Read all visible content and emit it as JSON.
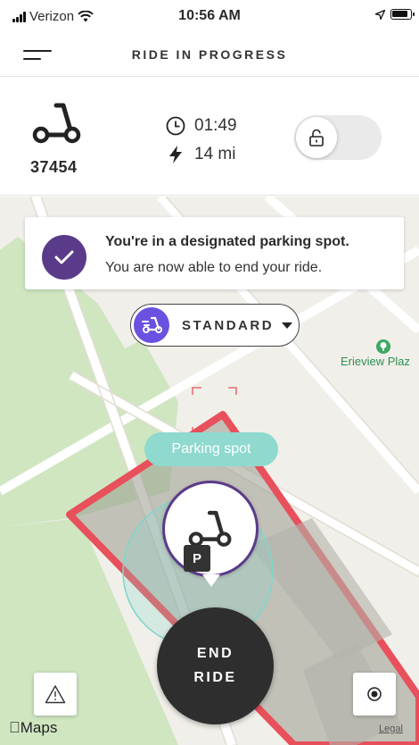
{
  "status_bar": {
    "carrier": "Verizon",
    "time": "10:56 AM"
  },
  "header": {
    "title": "RIDE IN PROGRESS",
    "menu_icon": "hamburger-menu-icon"
  },
  "ride": {
    "vehicle_id": "37454",
    "duration": "01:49",
    "range": "14 mi",
    "vehicle_icon": "scooter-icon",
    "lock_icon": "padlock-icon",
    "lock_state": "unlocked"
  },
  "notice": {
    "title": "You're in a designated parking spot.",
    "body": "You are now able to end your ride.",
    "icon": "check-icon",
    "color": "#5a3b8a"
  },
  "mode": {
    "label": "STANDARD",
    "color": "#6a51e0"
  },
  "map": {
    "poi_label": "Erieview Plaz",
    "parking_tooltip": "Parking spot",
    "parking_badge": "P",
    "zone_color": "#e8505b",
    "brand": "Maps",
    "legal": "Legal"
  },
  "actions": {
    "end_ride_line1": "END",
    "end_ride_line2": "RIDE",
    "report_icon": "warning-icon",
    "locate_icon": "location-target-icon"
  },
  "colors": {
    "accent_purple": "#5a3b8a",
    "parking_teal": "#8fd9cf",
    "end_button": "#2e2e2e"
  }
}
